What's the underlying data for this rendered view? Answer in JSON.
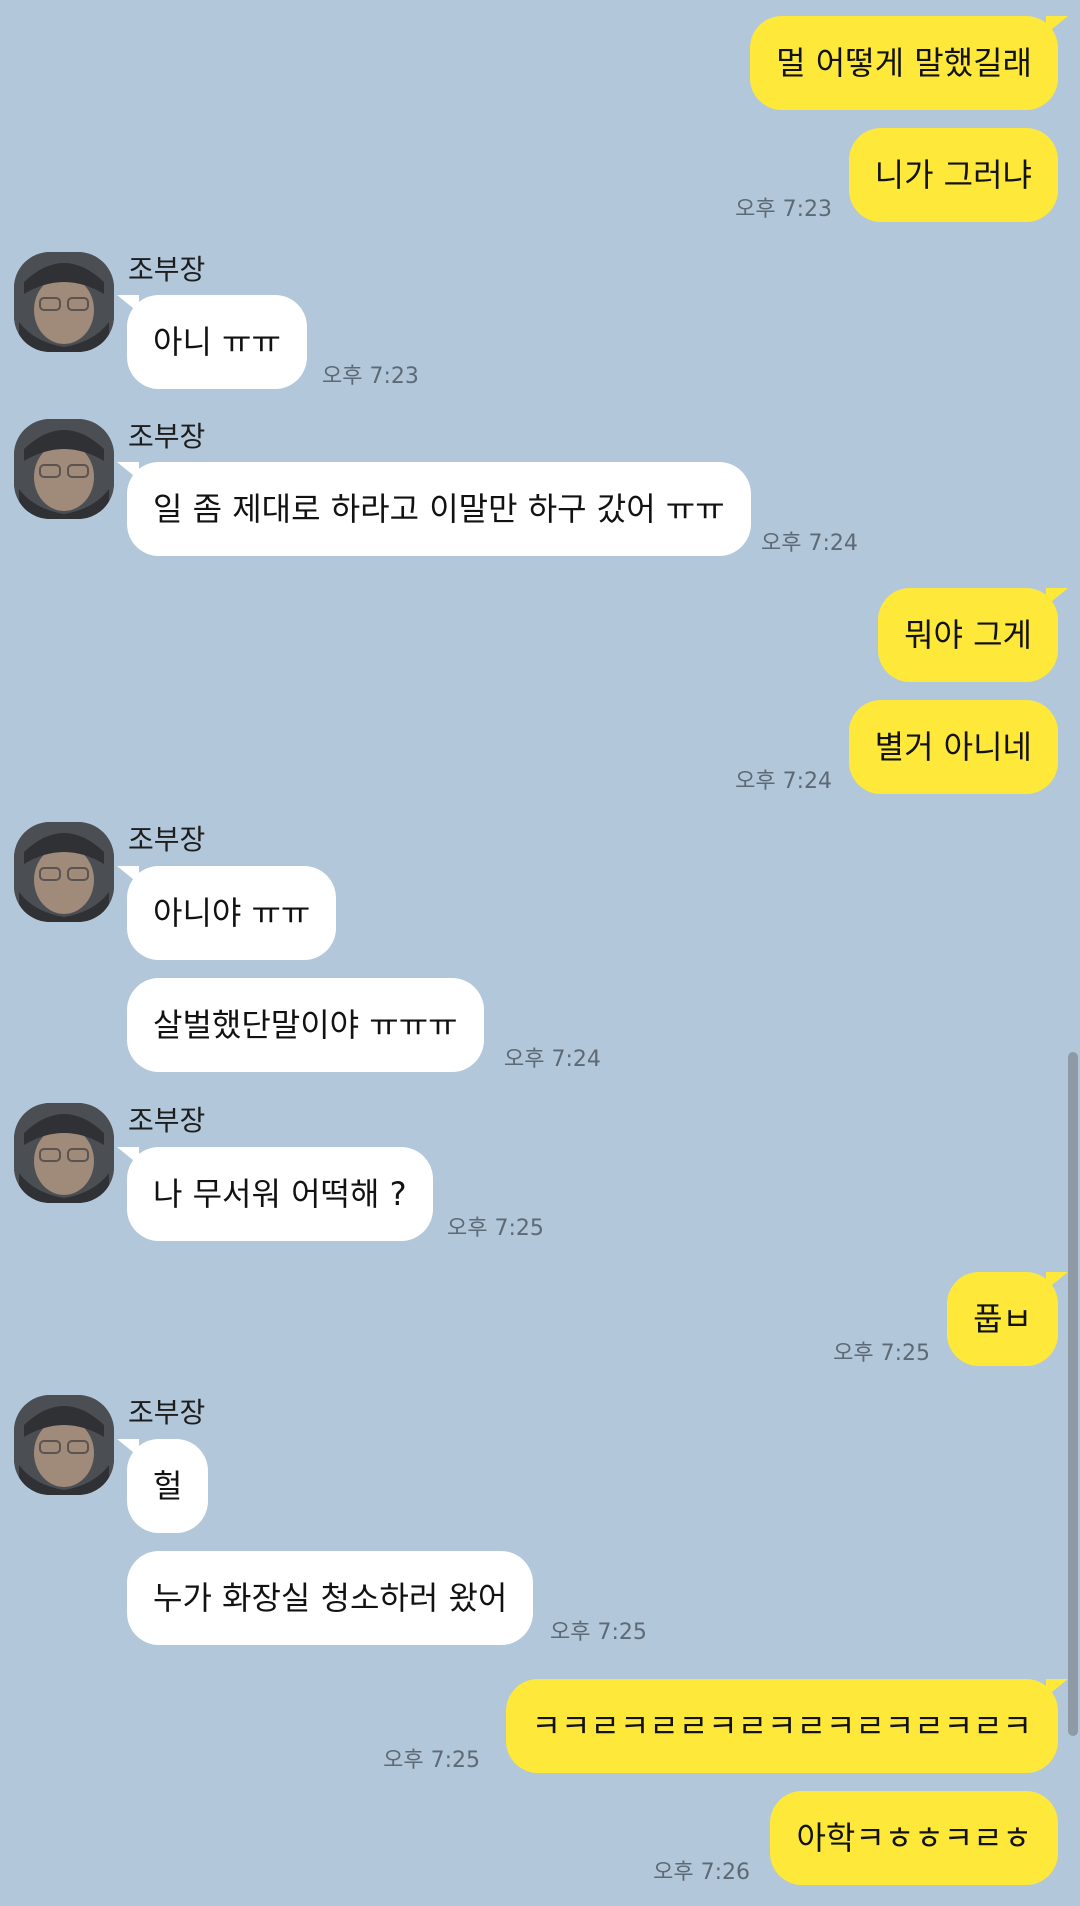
{
  "chat": {
    "contact_name": "조부장",
    "messages": [
      {
        "side": "out",
        "text": "멀 어떻게 말했길래"
      },
      {
        "side": "out",
        "text": "니가 그러냐",
        "time": "오후 7:23"
      },
      {
        "side": "in",
        "sender": "조부장",
        "text": "아니 ㅠㅠ",
        "time": "오후 7:23"
      },
      {
        "side": "in",
        "sender": "조부장",
        "text": "일 좀 제대로 하라고 이말만 하구 갔어 ㅠㅠ",
        "time": "오후 7:24"
      },
      {
        "side": "out",
        "text": "뭐야 그게"
      },
      {
        "side": "out",
        "text": "별거 아니네",
        "time": "오후 7:24"
      },
      {
        "side": "in",
        "sender": "조부장",
        "text": "아니야 ㅠㅠ"
      },
      {
        "side": "in",
        "text": "살벌했단말이야 ㅠㅠㅠ",
        "time": "오후 7:24"
      },
      {
        "side": "in",
        "sender": "조부장",
        "text": "나 무서워 어떡해 ?",
        "time": "오후 7:25"
      },
      {
        "side": "out",
        "text": "풉ㅂ",
        "time": "오후 7:25"
      },
      {
        "side": "in",
        "sender": "조부장",
        "text": "헐"
      },
      {
        "side": "in",
        "text": "누가 화장실 청소하러 왔어",
        "time": "오후 7:25"
      },
      {
        "side": "out",
        "text": "ㅋㅋㄹㅋㄹㄹㅋㄹㅋㄹㅋㄹㅋㄹㅋㄹㅋ",
        "time": "오후 7:25"
      },
      {
        "side": "out",
        "text": "아학ㅋㅎㅎㅋㄹㅎ",
        "time": "오후 7:26"
      }
    ]
  },
  "colors": {
    "background": "#b2c7da",
    "incoming_bubble": "#ffffff",
    "outgoing_bubble": "#fee93b",
    "timestamp": "#5d6a76"
  },
  "icons": {
    "avatar": "profile-photo-avatar"
  }
}
